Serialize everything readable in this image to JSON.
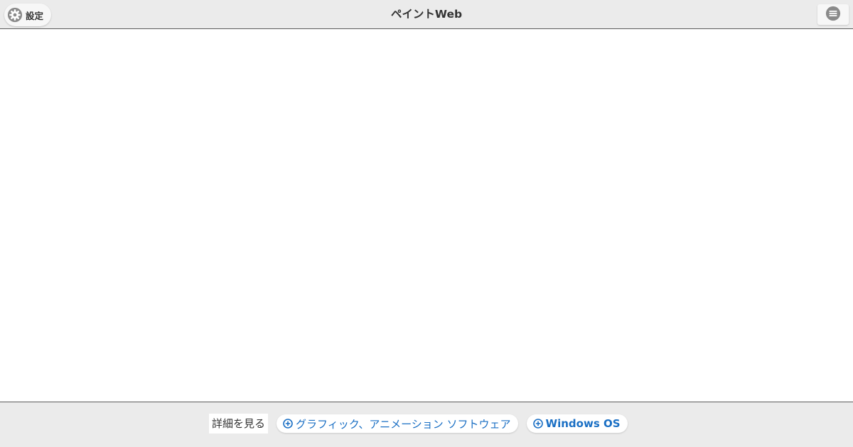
{
  "header": {
    "settings_label": "設定",
    "title": "ペイントWeb"
  },
  "footer": {
    "see_more": "詳細を見る",
    "chips": [
      {
        "label": "グラフィック、アニメーション ソフトウェア"
      },
      {
        "label": "Windows OS"
      }
    ]
  },
  "colors": {
    "bar_background": "#ebebeb",
    "link": "#1a6fc4",
    "icon_gray": "#8a8a8a"
  },
  "icons": {
    "settings": "gear-icon",
    "menu": "menu-icon",
    "chip": "plus-circle-icon"
  }
}
